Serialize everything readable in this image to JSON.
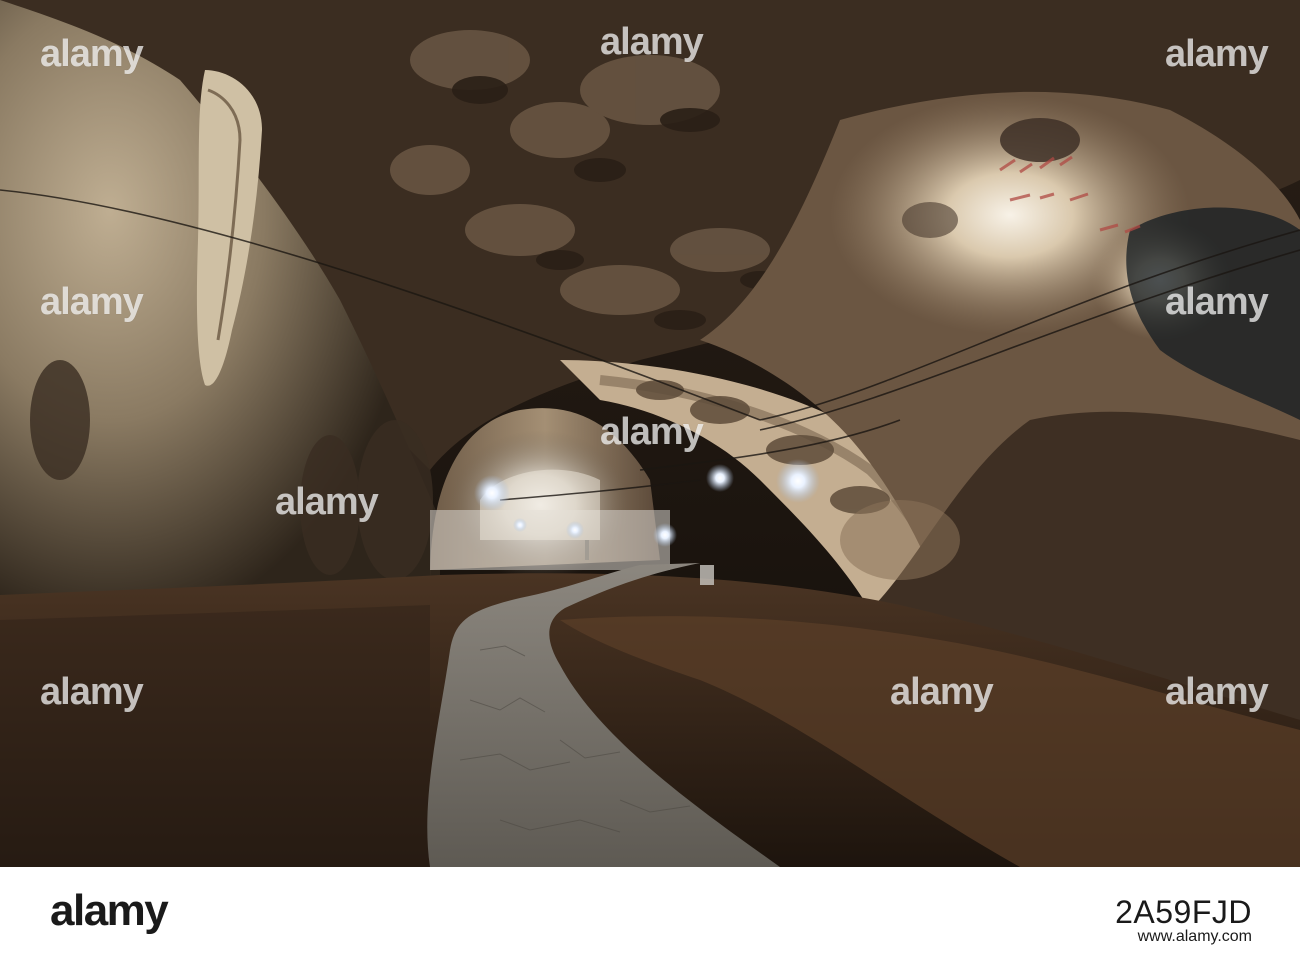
{
  "watermark": {
    "text": "alamy"
  },
  "footer": {
    "logo": "alamy",
    "image_id": "2A59FJD",
    "url": "www.alamy.com"
  }
}
